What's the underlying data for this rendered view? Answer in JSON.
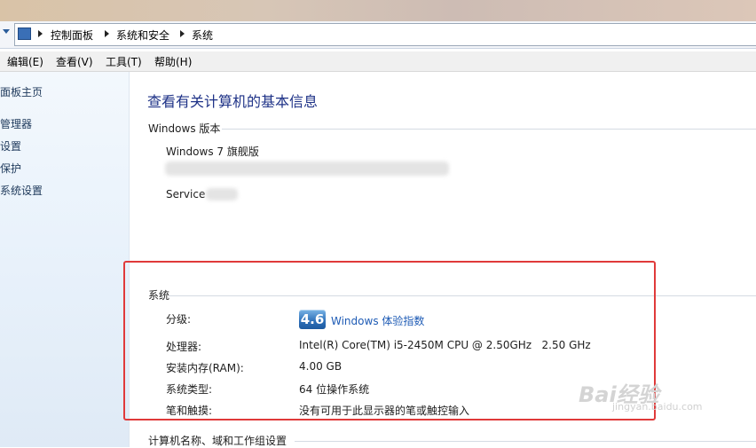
{
  "breadcrumb": [
    "控制面板",
    "系统和安全",
    "系统"
  ],
  "menu": [
    "编辑(E)",
    "查看(V)",
    "工具(T)",
    "帮助(H)"
  ],
  "sidebar": {
    "items": [
      "面板主页",
      "管理器",
      "设置",
      "保护",
      "系统设置"
    ]
  },
  "main": {
    "title": "查看有关计算机的基本信息",
    "windows_edition": {
      "heading": "Windows 版本",
      "edition": "Windows 7 旗舰版",
      "service_label": "Service"
    },
    "system": {
      "heading": "系统",
      "rating_label": "分级:",
      "rating_value": "4.6",
      "rating_link": "Windows 体验指数",
      "processor_label": "处理器:",
      "processor_value": "Intel(R) Core(TM) i5-2450M CPU @ 2.50GHz   2.50 GHz",
      "ram_label": "安装内存(RAM):",
      "ram_value": "4.00 GB",
      "type_label": "系统类型:",
      "type_value": "64 位操作系统",
      "pen_label": "笔和触摸:",
      "pen_value": "没有可用于此显示器的笔或触控输入"
    },
    "next_heading": "计算机名称、域和工作组设置"
  },
  "watermark": {
    "logo": "Bai经验",
    "url": "jingyan.baidu.com"
  },
  "colors": {
    "highlight_box": "#e03a3a",
    "link": "#1e5bb5",
    "title": "#1e3287"
  }
}
